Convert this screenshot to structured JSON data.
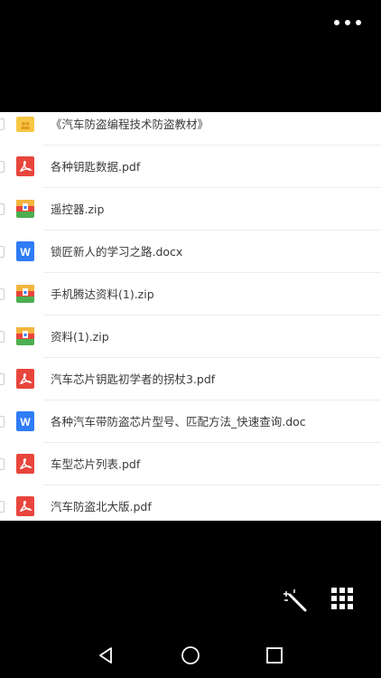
{
  "top_bar": {
    "more_icon": "more-dots-icon"
  },
  "files": [
    {
      "name": "《汽车防盗编程技术防盗教材》",
      "type": "folder",
      "icon": "folder-icon"
    },
    {
      "name": "各种钥匙数据.pdf",
      "type": "pdf",
      "icon": "pdf-icon"
    },
    {
      "name": "遥控器.zip",
      "type": "zip",
      "icon": "zip-icon"
    },
    {
      "name": "锁匠新人的学习之路.docx",
      "type": "doc",
      "icon": "word-doc-icon"
    },
    {
      "name": "手机腾达资料(1).zip",
      "type": "zip",
      "icon": "zip-icon"
    },
    {
      "name": "资料(1).zip",
      "type": "zip",
      "icon": "zip-icon"
    },
    {
      "name": "汽车芯片钥匙初学者的拐杖3.pdf",
      "type": "pdf",
      "icon": "pdf-icon"
    },
    {
      "name": "各种汽车带防盗芯片型号、匹配方法_快速查询.doc",
      "type": "doc",
      "icon": "word-doc-icon"
    },
    {
      "name": "车型芯片列表.pdf",
      "type": "pdf",
      "icon": "pdf-icon"
    },
    {
      "name": "汽车防盗北大版.pdf",
      "type": "pdf",
      "icon": "pdf-icon"
    }
  ],
  "bottom_actions": {
    "magic_icon": "magic-wand-icon",
    "grid_icon": "grid-menu-icon"
  },
  "nav_bar": {
    "back_icon": "back-icon",
    "home_icon": "home-icon",
    "recent_icon": "recent-apps-icon"
  },
  "colors": {
    "pdf": "#e8453c",
    "folder": "#f7c744",
    "word": "#2f7cf6",
    "zip_top": "#f3b53f",
    "zip_mid": "#e8453c",
    "zip_bottom": "#4caf50",
    "zip_side": "#2f7cf6"
  }
}
